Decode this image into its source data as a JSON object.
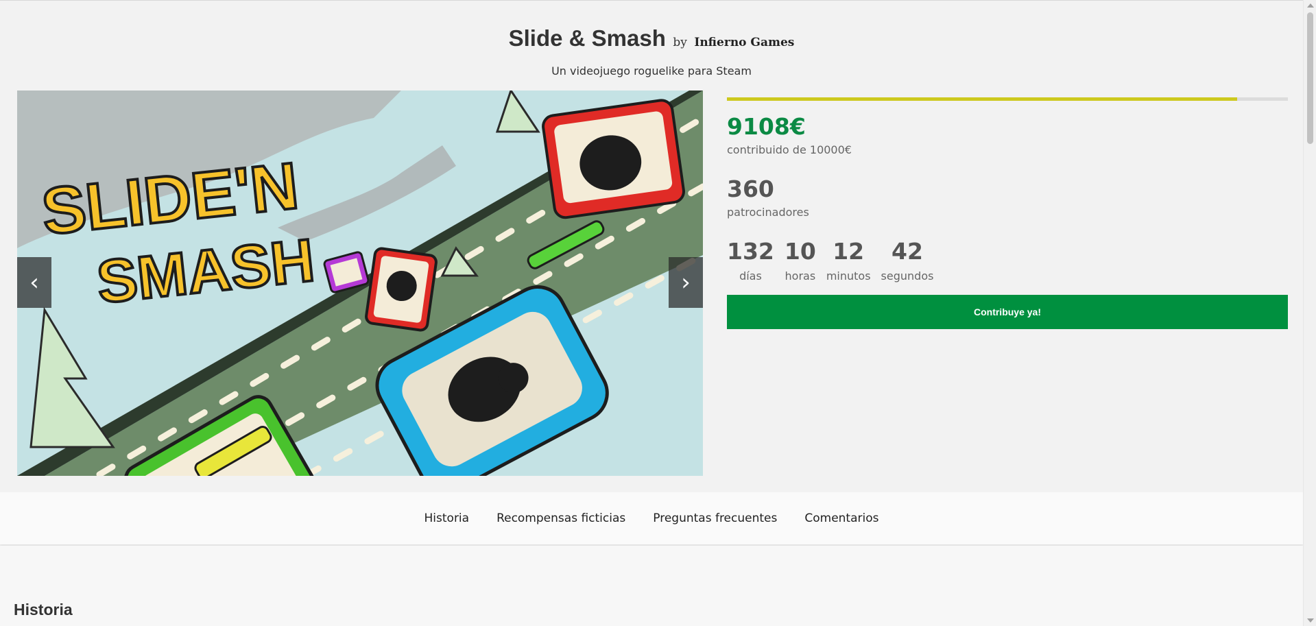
{
  "header": {
    "title": "Slide & Smash",
    "by": "by",
    "studio": "Infierno Games",
    "subtitle": "Un videojuego roguelike para Steam"
  },
  "carousel": {
    "prev_label": "‹",
    "next_label": "›",
    "logo_text_line1": "SLIDE'N",
    "logo_text_line2": "SMASH"
  },
  "campaign": {
    "progress_fraction": 0.91,
    "progress_color": "#cdc91e",
    "amount": "9108€",
    "amount_label": "contribuido de 10000€",
    "backers": "360",
    "backers_label": "patrocinadores",
    "countdown": [
      {
        "value": "132",
        "label": "días"
      },
      {
        "value": "10",
        "label": "horas"
      },
      {
        "value": "12",
        "label": "minutos"
      },
      {
        "value": "42",
        "label": "segundos"
      }
    ],
    "cta_label": "Contribuye ya!",
    "accent_color": "#00903f"
  },
  "tabs": [
    {
      "label": "Historia"
    },
    {
      "label": "Recompensas ficticias"
    },
    {
      "label": "Preguntas frecuentes"
    },
    {
      "label": "Comentarios"
    }
  ],
  "section": {
    "title": "Historia"
  }
}
